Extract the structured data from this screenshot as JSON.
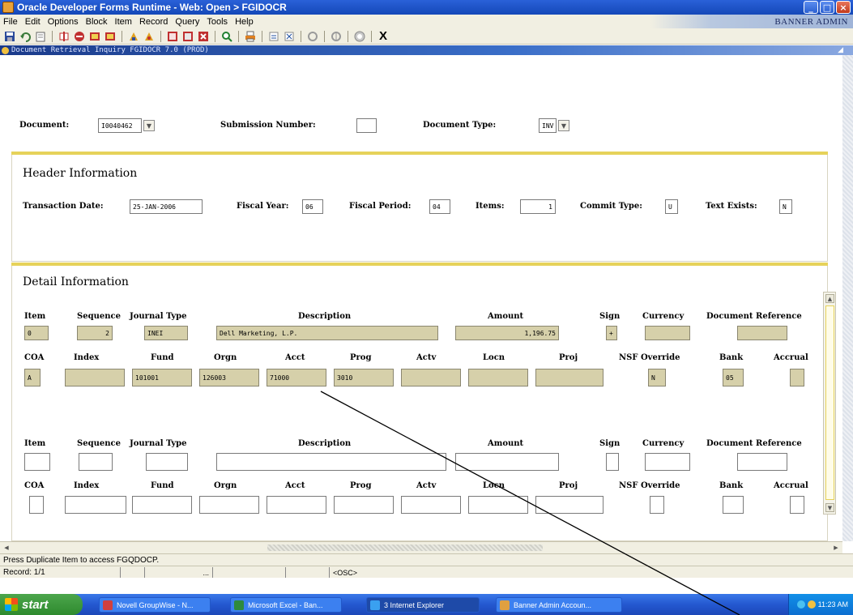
{
  "window": {
    "title": "Oracle Developer Forms Runtime - Web: Open > FGIDOCR",
    "min": "_",
    "max": "□",
    "close": "×"
  },
  "menu": {
    "items": [
      "File",
      "Edit",
      "Options",
      "Block",
      "Item",
      "Record",
      "Query",
      "Tools",
      "Help"
    ],
    "brand": "BANNER ADMIN"
  },
  "toolbar": {
    "exit_label": "X"
  },
  "form": {
    "title": "Document Retrieval Inquiry  FGIDOCR  7.0  (PROD)"
  },
  "key": {
    "document_label": "Document:",
    "document_value": "I0040462",
    "submission_label": "Submission Number:",
    "submission_value": "",
    "doctype_label": "Document Type:",
    "doctype_value": "INV"
  },
  "header": {
    "title": "Header Information",
    "trans_date_label": "Transaction Date:",
    "trans_date_value": "25-JAN-2006",
    "fiscal_year_label": "Fiscal Year:",
    "fiscal_year_value": "06",
    "fiscal_period_label": "Fiscal Period:",
    "fiscal_period_value": "04",
    "items_label": "Items:",
    "items_value": "1",
    "commit_label": "Commit Type:",
    "commit_value": "U",
    "text_label": "Text Exists:",
    "text_value": "N"
  },
  "detail": {
    "title": "Detail Information",
    "row_headers": {
      "item": "Item",
      "sequence": "Sequence",
      "journal_type": "Journal Type",
      "description": "Description",
      "amount": "Amount",
      "sign": "Sign",
      "currency": "Currency",
      "doc_ref": "Document Reference"
    },
    "acct_headers": {
      "coa": "COA",
      "index": "Index",
      "fund": "Fund",
      "orgn": "Orgn",
      "acct": "Acct",
      "prog": "Prog",
      "actv": "Actv",
      "locn": "Locn",
      "proj": "Proj",
      "nsf": "NSF Override",
      "bank": "Bank",
      "accrual": "Accrual"
    },
    "records": [
      {
        "item": "0",
        "sequence": "2",
        "journal_type": "INEI",
        "description": "Dell Marketing, L.P.",
        "amount": "1,196.75",
        "sign": "+",
        "currency": "",
        "doc_ref": "",
        "coa": "A",
        "index": "",
        "fund": "101001",
        "orgn": "126003",
        "acct": "71000",
        "prog": "3010",
        "actv": "",
        "locn": "",
        "proj": "",
        "nsf": "N",
        "bank": "05",
        "accrual": ""
      },
      {
        "item": "",
        "sequence": "",
        "journal_type": "",
        "description": "",
        "amount": "",
        "sign": "",
        "currency": "",
        "doc_ref": "",
        "coa": "",
        "index": "",
        "fund": "",
        "orgn": "",
        "acct": "",
        "prog": "",
        "actv": "",
        "locn": "",
        "proj": "",
        "nsf": "",
        "bank": "",
        "accrual": ""
      }
    ]
  },
  "status": {
    "hint": "Press Duplicate Item to access FGQDOCP.",
    "record": "Record: 1/1",
    "cell3": "...",
    "mode": "<OSC>"
  },
  "taskbar": {
    "start": "start",
    "tasks": [
      {
        "label": "Novell GroupWise - N..."
      },
      {
        "label": "Microsoft Excel - Ban..."
      },
      {
        "label": "3 Internet Explorer"
      },
      {
        "label": "Banner Admin Accoun..."
      }
    ],
    "clock": "11:23 AM"
  },
  "colors": {
    "tan_field": "#d6d0aa",
    "accent_yellow": "#e6d25a",
    "title_blue": "#1448b8"
  }
}
